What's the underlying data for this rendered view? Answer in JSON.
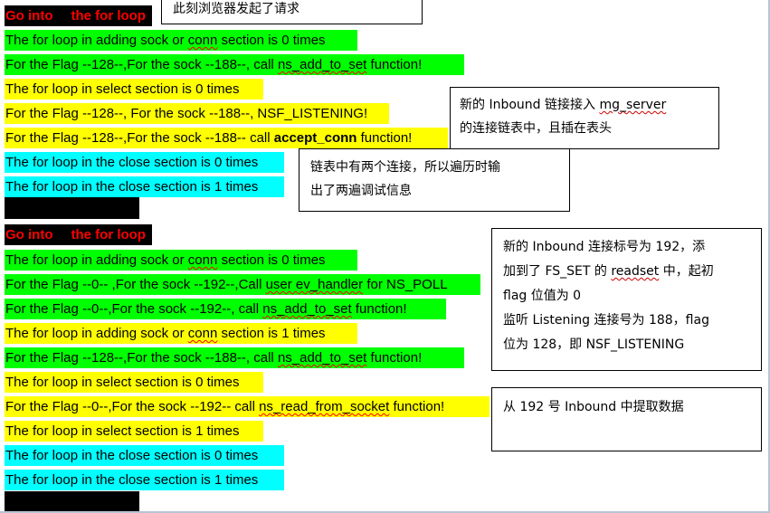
{
  "header1": {
    "part1": "Go into",
    "part2": "the for loop"
  },
  "header2": {
    "part1": "Go into",
    "part2": "the for loop"
  },
  "lines": {
    "l1": {
      "pre": "The for loop in adding sock or ",
      "u1": "conn",
      "post": " section is 0 times"
    },
    "l2": {
      "pre": "For the Flag --128--,For the sock --188--, call ",
      "u1": "ns_add_to_set",
      "post": " function!"
    },
    "l3": {
      "text": "The for loop in select section is 0 times"
    },
    "l4": {
      "text": "For the Flag --128--, For the sock --188--, NSF_LISTENING!"
    },
    "l5": {
      "pre": "For the Flag --128--,For the sock --188-- call ",
      "b1": "accept_conn",
      "post": " function!"
    },
    "l6": {
      "text": "The for loop in the close section is 0 times"
    },
    "l7": {
      "text": "The for loop in the close section is 1 times"
    },
    "m1": {
      "pre": "The for loop in adding sock or ",
      "u1": "conn",
      "post": " section is 0 times"
    },
    "m2": {
      "pre": "For the Flag --0-- ,For the sock --192--,Call ",
      "u1": "user ev_handler",
      "post": " for NS_POLL"
    },
    "m3": {
      "pre": "For the Flag --0--,For the sock --192--, call ",
      "u1": "ns_add_to_set",
      "post": " function!"
    },
    "m4": {
      "pre": "The for loop in adding sock or ",
      "u1": "conn",
      "post": " section is 1 times"
    },
    "m5": {
      "pre": "For the Flag --128--,For the sock --188--, call ",
      "u1": "ns_add_to_set",
      "post": " function!"
    },
    "m6": {
      "text": "The for loop in select section is 0 times"
    },
    "m7": {
      "pre": "For the Flag --0--,For the sock --192-- call ",
      "u1": "ns_read_from_socket",
      "post": " function!"
    },
    "m8": {
      "text": "The for loop in select section is 1 times"
    },
    "m9": {
      "text": "The for loop in the close section is 0 times"
    },
    "m10": {
      "text": "The for loop in the close section is 1 times"
    }
  },
  "notes": {
    "n1": {
      "line1": "此刻浏览器发起了请求"
    },
    "n2": {
      "line1_pre": "新的  Inbound  链接接入  ",
      "line1_u": "mg_server",
      "line2": "的连接链表中，且插在表头"
    },
    "n3": {
      "line1": "链表中有两个连接，所以遍历时输",
      "line2": "出了两遍调试信息"
    },
    "n4": {
      "line1": "新的 Inbound 连接标号为 192，添",
      "line2_pre": "加到了 FS_SET 的 ",
      "line2_u": "readset",
      "line2_post": " 中，起初",
      "line3": "flag 位值为 0",
      "line4": "监听  Listening  连接号为  188，flag",
      "line5": "位为 128，即 NSF_LISTENING"
    },
    "n5": {
      "line1": "从 192 号 Inbound 中提取数据"
    }
  },
  "colors": {
    "green": "#00ff00",
    "yellow": "#ffff00",
    "cyan": "#00ffff",
    "black": "#000000",
    "header_text": "#ff0000"
  }
}
